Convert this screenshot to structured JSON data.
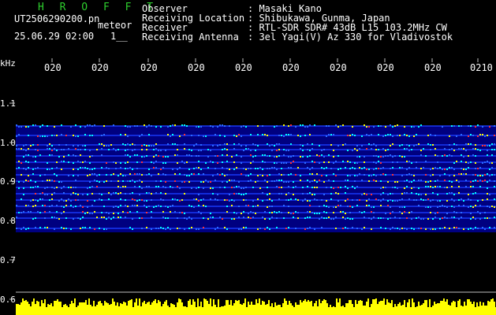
{
  "header": {
    "title": "H R O F F T",
    "filename": "UT2506290200.pn",
    "mode": "meteor",
    "datetime": "25.06.29 02:00",
    "counter": "1__",
    "info_labels": [
      "Observer",
      "Receiving Location",
      "Receiver",
      "Receiving Antenna"
    ],
    "info_values": [
      ": Masaki Kano",
      ": Shibukawa, Gunma, Japan",
      ": RTL-SDR SDR# 43dB L15 103.2MHz CW",
      ": 3el Yagi(V) Az 330 for Vladivostok"
    ]
  },
  "axis": {
    "unit": "kHz",
    "y_ticks": [
      "1.1",
      "1.0",
      "0.9",
      "0.8",
      "0.7",
      "0.6"
    ],
    "x_ticks": [
      "020",
      "020",
      "020",
      "020",
      "020",
      "020",
      "020",
      "020",
      "020",
      "0210"
    ]
  },
  "colors": {
    "title": "#2ecf2e",
    "text": "#ffffff",
    "background": "#000000",
    "spectrogram_bg": "#000080",
    "signal_yellow": "#ffff00",
    "signal_cyan": "#00ffff",
    "signal_red": "#ff3030",
    "grid": "#c0c0c0"
  }
}
